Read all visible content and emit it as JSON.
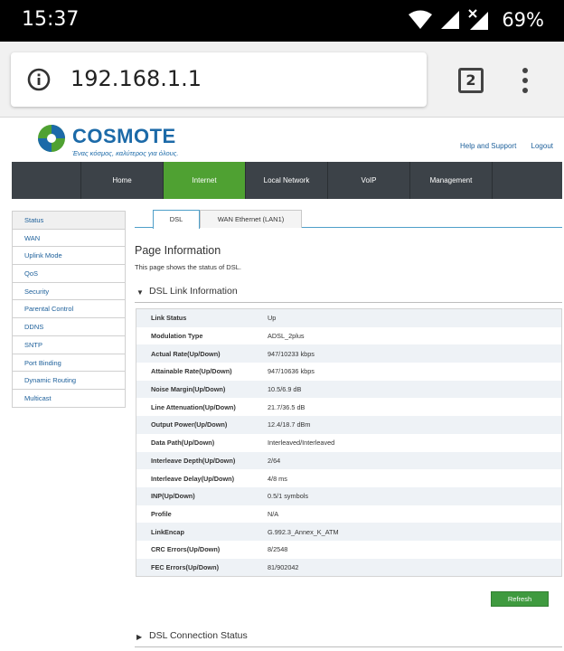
{
  "status_bar": {
    "time": "15:37",
    "battery": "69%"
  },
  "browser": {
    "url": "192.168.1.1",
    "tab_count": "2"
  },
  "header": {
    "logo_text": "COSMOTE",
    "tagline": "Ένας κόσμος, καλύτερος για όλους.",
    "help_link": "Help and Support",
    "logout_link": "Logout"
  },
  "main_nav": [
    {
      "label": "Home",
      "active": false
    },
    {
      "label": "Internet",
      "active": true
    },
    {
      "label": "Local Network",
      "active": false
    },
    {
      "label": "VoIP",
      "active": false
    },
    {
      "label": "Management",
      "active": false
    }
  ],
  "sidebar": [
    {
      "label": "Status",
      "active": true
    },
    {
      "label": "WAN"
    },
    {
      "label": "Uplink Mode"
    },
    {
      "label": "QoS"
    },
    {
      "label": "Security"
    },
    {
      "label": "Parental Control"
    },
    {
      "label": "DDNS"
    },
    {
      "label": "SNTP"
    },
    {
      "label": "Port Binding"
    },
    {
      "label": "Dynamic Routing"
    },
    {
      "label": "Multicast"
    }
  ],
  "tabs": [
    {
      "label": "DSL",
      "active": true
    },
    {
      "label": "WAN Ethernet (LAN1)",
      "active": false
    }
  ],
  "page_info": {
    "title": "Page Information",
    "description": "This page shows the status of DSL."
  },
  "dsl_section": {
    "title": "DSL Link Information",
    "rows": [
      {
        "key": "Link Status",
        "value": "Up"
      },
      {
        "key": "Modulation Type",
        "value": "ADSL_2plus"
      },
      {
        "key": "Actual Rate(Up/Down)",
        "value": "947/10233 kbps"
      },
      {
        "key": "Attainable Rate(Up/Down)",
        "value": "947/10636 kbps"
      },
      {
        "key": "Noise Margin(Up/Down)",
        "value": "10.5/6.9 dB"
      },
      {
        "key": "Line Attenuation(Up/Down)",
        "value": "21.7/36.5 dB"
      },
      {
        "key": "Output Power(Up/Down)",
        "value": "12.4/18.7 dBm"
      },
      {
        "key": "Data Path(Up/Down)",
        "value": "Interleaved/Interleaved"
      },
      {
        "key": "Interleave Depth(Up/Down)",
        "value": "2/64"
      },
      {
        "key": "Interleave Delay(Up/Down)",
        "value": "4/8 ms"
      },
      {
        "key": "INP(Up/Down)",
        "value": "0.5/1 symbols"
      },
      {
        "key": "Profile",
        "value": "N/A"
      },
      {
        "key": "LinkEncap",
        "value": "G.992.3_Annex_K_ATM"
      },
      {
        "key": "CRC Errors(Up/Down)",
        "value": "8/2548"
      },
      {
        "key": "FEC Errors(Up/Down)",
        "value": "81/902042"
      }
    ]
  },
  "refresh_button": "Refresh",
  "connection_section": {
    "title": "DSL Connection Status"
  },
  "colors": {
    "brand_green": "#4fa132",
    "brand_blue": "#1c6aa8",
    "nav_bg": "#3c4248"
  }
}
